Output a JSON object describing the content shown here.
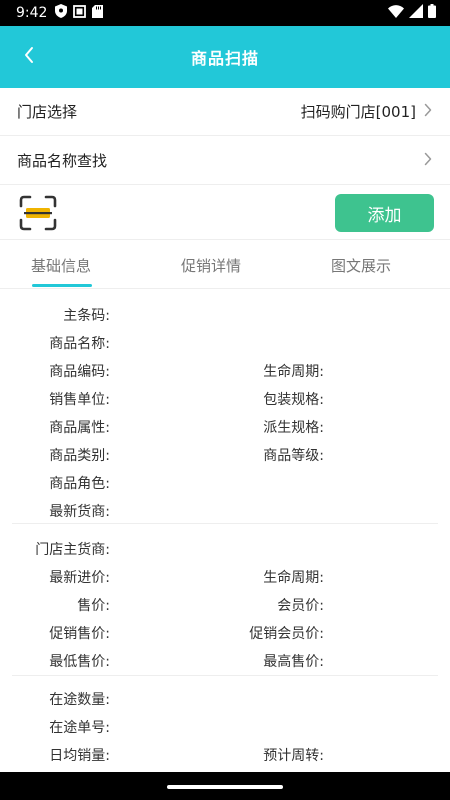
{
  "status": {
    "time": "9:42",
    "left_icons": [
      "shield-icon",
      "square-icon",
      "sd-card-icon"
    ],
    "right_icons": [
      "wifi-icon",
      "signal-icon",
      "battery-icon"
    ]
  },
  "app_bar": {
    "title": "商品扫描",
    "color": "#22c8d8"
  },
  "store_row": {
    "label": "门店选择",
    "value": "扫码购门店[001]"
  },
  "name_row": {
    "label": "商品名称查找"
  },
  "scan": {
    "add_label": "添加",
    "add_color": "#3ec38f"
  },
  "tabs": [
    {
      "label": "基础信息",
      "active": true
    },
    {
      "label": "促销详情",
      "active": false
    },
    {
      "label": "图文展示",
      "active": false
    }
  ],
  "section1": [
    {
      "left": "主条码:",
      "right": ""
    },
    {
      "left": "商品名称:",
      "right": ""
    },
    {
      "left": "商品编码:",
      "right": "生命周期:"
    },
    {
      "left": "销售单位:",
      "right": "包装规格:"
    },
    {
      "left": "商品属性:",
      "right": "派生规格:"
    },
    {
      "left": "商品类别:",
      "right": "商品等级:"
    },
    {
      "left": "商品角色:",
      "right": ""
    },
    {
      "left": "最新货商:",
      "right": ""
    }
  ],
  "section2": [
    {
      "left": "门店主货商:",
      "right": ""
    },
    {
      "left": "最新进价:",
      "right": "生命周期:"
    },
    {
      "left": "售价:",
      "right": "会员价:"
    },
    {
      "left": "促销售价:",
      "right": "促销会员价:"
    },
    {
      "left": "最低售价:",
      "right": "最高售价:"
    }
  ],
  "section3": [
    {
      "left": "在途数量:",
      "right": ""
    },
    {
      "left": "在途单号:",
      "right": ""
    },
    {
      "left": "日均销量:",
      "right": "预计周转:"
    }
  ]
}
